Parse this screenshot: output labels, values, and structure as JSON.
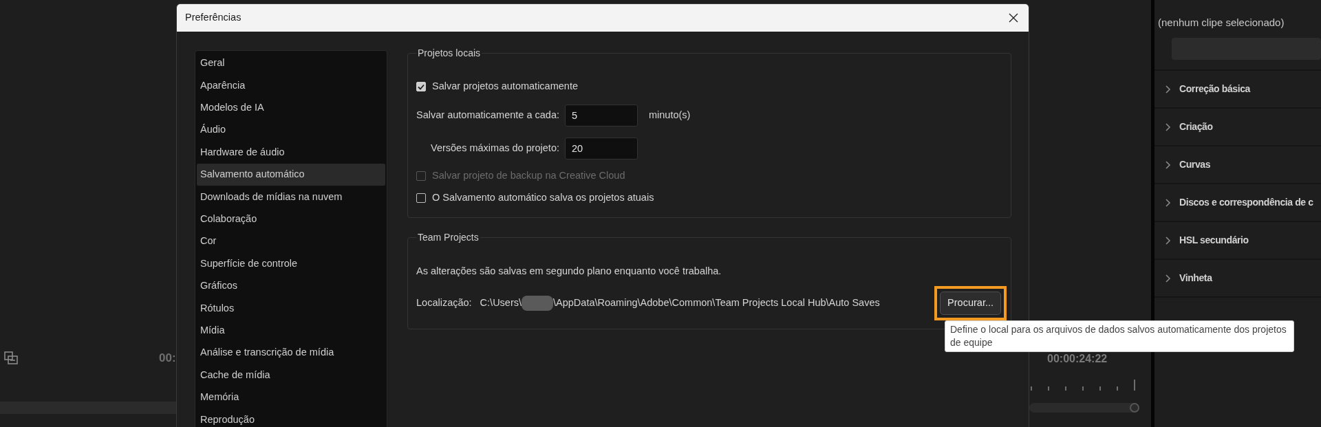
{
  "background": {
    "left_timecode": "00:",
    "right_timecode": "00:00:24:22",
    "panel": {
      "status": "(nenhum clipe selecionado)",
      "sections": [
        {
          "label": "Correção básica",
          "expanded": false
        },
        {
          "label": "Criação",
          "expanded": false
        },
        {
          "label": "Curvas",
          "expanded": false
        },
        {
          "label": "Discos e correspondência de c",
          "expanded": false
        },
        {
          "label": "HSL secundário",
          "expanded": false
        },
        {
          "label": "Vinheta",
          "expanded": false
        }
      ]
    }
  },
  "dialog": {
    "title": "Preferências",
    "categories": [
      {
        "label": "Geral",
        "selected": false
      },
      {
        "label": "Aparência",
        "selected": false
      },
      {
        "label": "Modelos de IA",
        "selected": false
      },
      {
        "label": "Áudio",
        "selected": false
      },
      {
        "label": "Hardware de áudio",
        "selected": false
      },
      {
        "label": "Salvamento automático",
        "selected": true
      },
      {
        "label": "Downloads de mídias na nuvem",
        "selected": false
      },
      {
        "label": "Colaboração",
        "selected": false
      },
      {
        "label": "Cor",
        "selected": false
      },
      {
        "label": "Superfície de controle",
        "selected": false
      },
      {
        "label": "Gráficos",
        "selected": false
      },
      {
        "label": "Rótulos",
        "selected": false
      },
      {
        "label": "Mídia",
        "selected": false
      },
      {
        "label": "Análise e transcrição de mídia",
        "selected": false
      },
      {
        "label": "Cache de mídia",
        "selected": false
      },
      {
        "label": "Memória",
        "selected": false
      },
      {
        "label": "Reprodução",
        "selected": false
      }
    ],
    "local_projects": {
      "legend": "Projetos locais",
      "items": [
        {
          "kind": "checkbox",
          "label": "Salvar projetos automaticamente",
          "checked": true,
          "disabled": false
        },
        {
          "kind": "field",
          "label": "Salvar automaticamente a cada:",
          "value": "5",
          "unit": "minuto(s)"
        },
        {
          "kind": "field",
          "label": "Versões máximas do projeto:",
          "value": "20"
        },
        {
          "kind": "checkbox",
          "label": "Salvar projeto de backup na Creative Cloud",
          "checked": false,
          "disabled": true
        },
        {
          "kind": "checkbox",
          "label": "O Salvamento automático salva os projetos atuais",
          "checked": false,
          "disabled": false
        }
      ]
    },
    "team_projects": {
      "legend": "Team Projects",
      "note": "As alterações são salvas em segundo plano enquanto você trabalha.",
      "location_label": "Localização:",
      "path": [
        {
          "kind": "text",
          "text": "C:\\Users\\"
        },
        {
          "kind": "redacted"
        },
        {
          "kind": "text",
          "text": "\\AppData\\Roaming\\Adobe\\Common\\Team Projects Local Hub\\Auto Saves"
        }
      ],
      "button": {
        "label": "Procurar...",
        "highlighted": true
      }
    },
    "tooltip": "Define o local para os arquivos de dados salvos automaticamente dos projetos de equipe"
  }
}
